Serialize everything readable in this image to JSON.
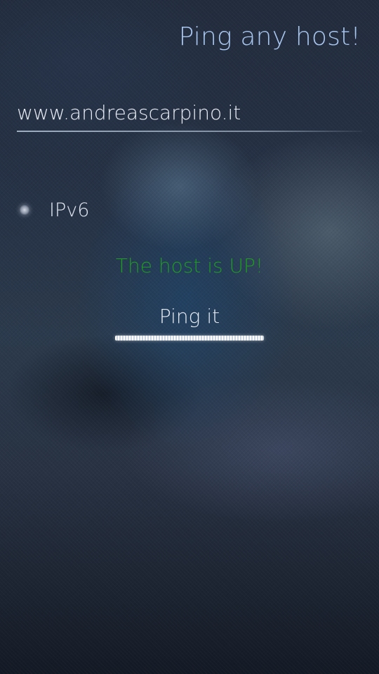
{
  "page": {
    "title": "Ping any host!"
  },
  "host_field": {
    "value": "www.andreascarpino.it",
    "placeholder": ""
  },
  "ipv6_switch": {
    "label": "IPv6",
    "checked": false
  },
  "status": {
    "text": "The host is UP!",
    "color": "#1f9a24"
  },
  "ping_button": {
    "label": "Ping it"
  },
  "colors": {
    "title": "#a9c6ef",
    "text": "#e6ebf3",
    "status_ok": "#1f9a24"
  }
}
